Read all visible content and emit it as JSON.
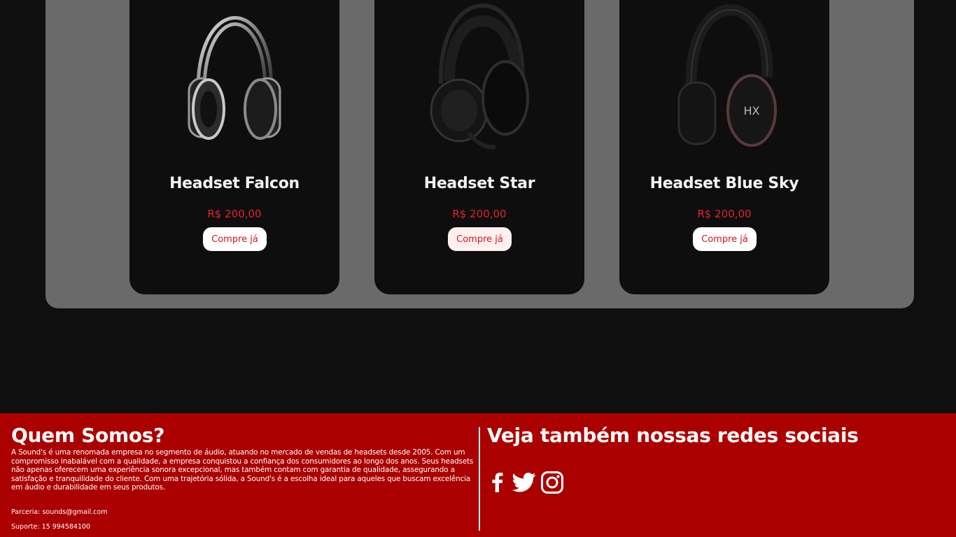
{
  "products": [
    {
      "name": "Headset Falcon",
      "price": "R$ 200,00",
      "button": "Compre já",
      "image": "silver-black-headset"
    },
    {
      "name": "Headset Star",
      "price": "R$ 200,00",
      "button": "Compre já",
      "image": "black-gaming-headset-with-mic"
    },
    {
      "name": "Headset Blue Sky",
      "price": "R$ 200,00",
      "button": "Compre já",
      "image": "hyperx-black-headset"
    }
  ],
  "footer": {
    "about_title": "Quem Somos?",
    "about_text": "A Sound's é uma renomada empresa no segmento de áudio, atuando no mercado de vendas de headsets desde 2005. Com um compromisso inabalável com a qualidade, a empresa conquistou a confiança dos consumidores ao longo dos anos. Seus headsets não apenas oferecem uma experiência sonora excepcional, mas também contam com garantia de qualidade, assegurando a satisfação e tranquilidade do cliente. Com uma trajetória sólida, a Sound's é a escolha ideal para aqueles que buscam excelência em áudio e durabilidade em seus produtos.",
    "partner": "Parceria: sounds@gmail.com",
    "support": "Suporte: 15 994584100",
    "social_title": "Veja também nossas redes sociais",
    "social_icons": [
      "facebook-icon",
      "twitter-icon",
      "instagram-icon"
    ]
  },
  "colors": {
    "page_bg": "#0f0f10",
    "panel_bg": "#6b6a6b",
    "card_bg": "#0e0e0f",
    "price": "#e3222a",
    "footer_bg": "#ab0000"
  }
}
